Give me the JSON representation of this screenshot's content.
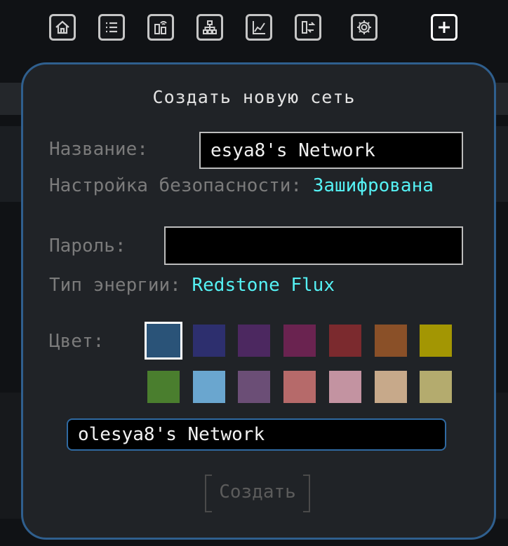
{
  "toolbar": {
    "items": [
      {
        "icon": "home-icon"
      },
      {
        "icon": "list-icon"
      },
      {
        "icon": "wireless-connector-icon"
      },
      {
        "icon": "network-tree-icon"
      },
      {
        "icon": "statistics-chart-icon"
      },
      {
        "icon": "transfer-icon"
      },
      {
        "icon": "gear-icon"
      },
      {
        "icon": "plus-icon"
      }
    ]
  },
  "dialog": {
    "title": "Создать новую сеть",
    "name_label": "Название:",
    "name_value": "esya8's Network",
    "security_label": "Настройка безопасности:",
    "security_value": "Зашифрована",
    "password_label": "Пароль:",
    "password_value": "",
    "energy_label": "Тип энергии:",
    "energy_value": "Redstone Flux",
    "color_label": "Цвет:",
    "colors": [
      "#2a5378",
      "#2d2f6e",
      "#4c2860",
      "#6a2350",
      "#7b2a2e",
      "#8a5028",
      "#a39603",
      "#4a7e2e",
      "#6aa6cf",
      "#6b4e76",
      "#b66a6a",
      "#c393a1",
      "#c7a98a",
      "#b4ab6e"
    ],
    "selected_color_index": 0,
    "network_name_preview": "olesya8's Network",
    "create_label": "Создать"
  }
}
